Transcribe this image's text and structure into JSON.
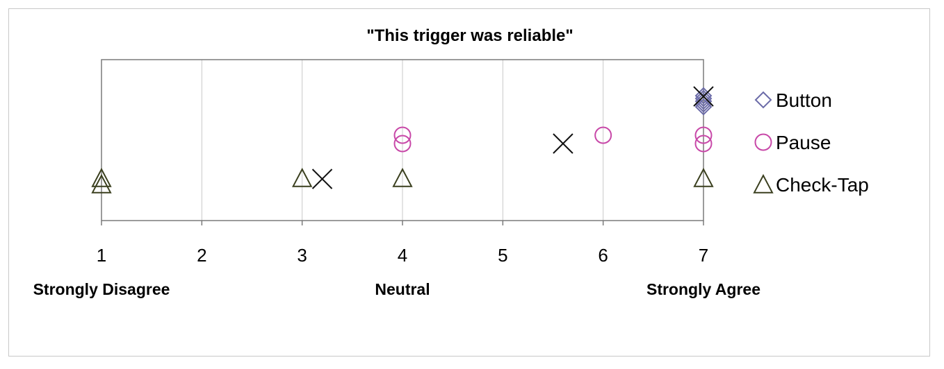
{
  "chart_data": {
    "type": "scatter",
    "title": "\"This trigger was reliable\"",
    "xlabel": "",
    "ylabel": "",
    "xlim": [
      1,
      7
    ],
    "x_ticks": [
      "1",
      "2",
      "3",
      "4",
      "5",
      "6",
      "7"
    ],
    "anchor_labels": [
      {
        "x": 1,
        "text": "Strongly Disagree"
      },
      {
        "x": 4,
        "text": "Neutral"
      },
      {
        "x": 7,
        "text": "Strongly Agree"
      }
    ],
    "grid": true,
    "legend_position": "right",
    "series": [
      {
        "name": "Button",
        "marker": "diamond",
        "color": "#6b6ba8",
        "points": [
          {
            "x": 7,
            "row": 0
          },
          {
            "x": 7,
            "row": 0
          },
          {
            "x": 7,
            "row": 0
          },
          {
            "x": 7,
            "row": 0
          },
          {
            "x": 7,
            "row": 0
          }
        ],
        "mean": 7
      },
      {
        "name": "Pause",
        "marker": "circle",
        "color": "#c848a8",
        "points": [
          {
            "x": 4,
            "row": 1
          },
          {
            "x": 4,
            "row": 1
          },
          {
            "x": 6,
            "row": 1
          },
          {
            "x": 7,
            "row": 1
          },
          {
            "x": 7,
            "row": 1
          }
        ],
        "mean": 5.6
      },
      {
        "name": "Check-Tap",
        "marker": "triangle",
        "color": "#3a3f1e",
        "points": [
          {
            "x": 1,
            "row": 2
          },
          {
            "x": 1,
            "row": 2
          },
          {
            "x": 3,
            "row": 2
          },
          {
            "x": 4,
            "row": 2
          },
          {
            "x": 7,
            "row": 2
          }
        ],
        "mean": 3.2
      }
    ]
  }
}
